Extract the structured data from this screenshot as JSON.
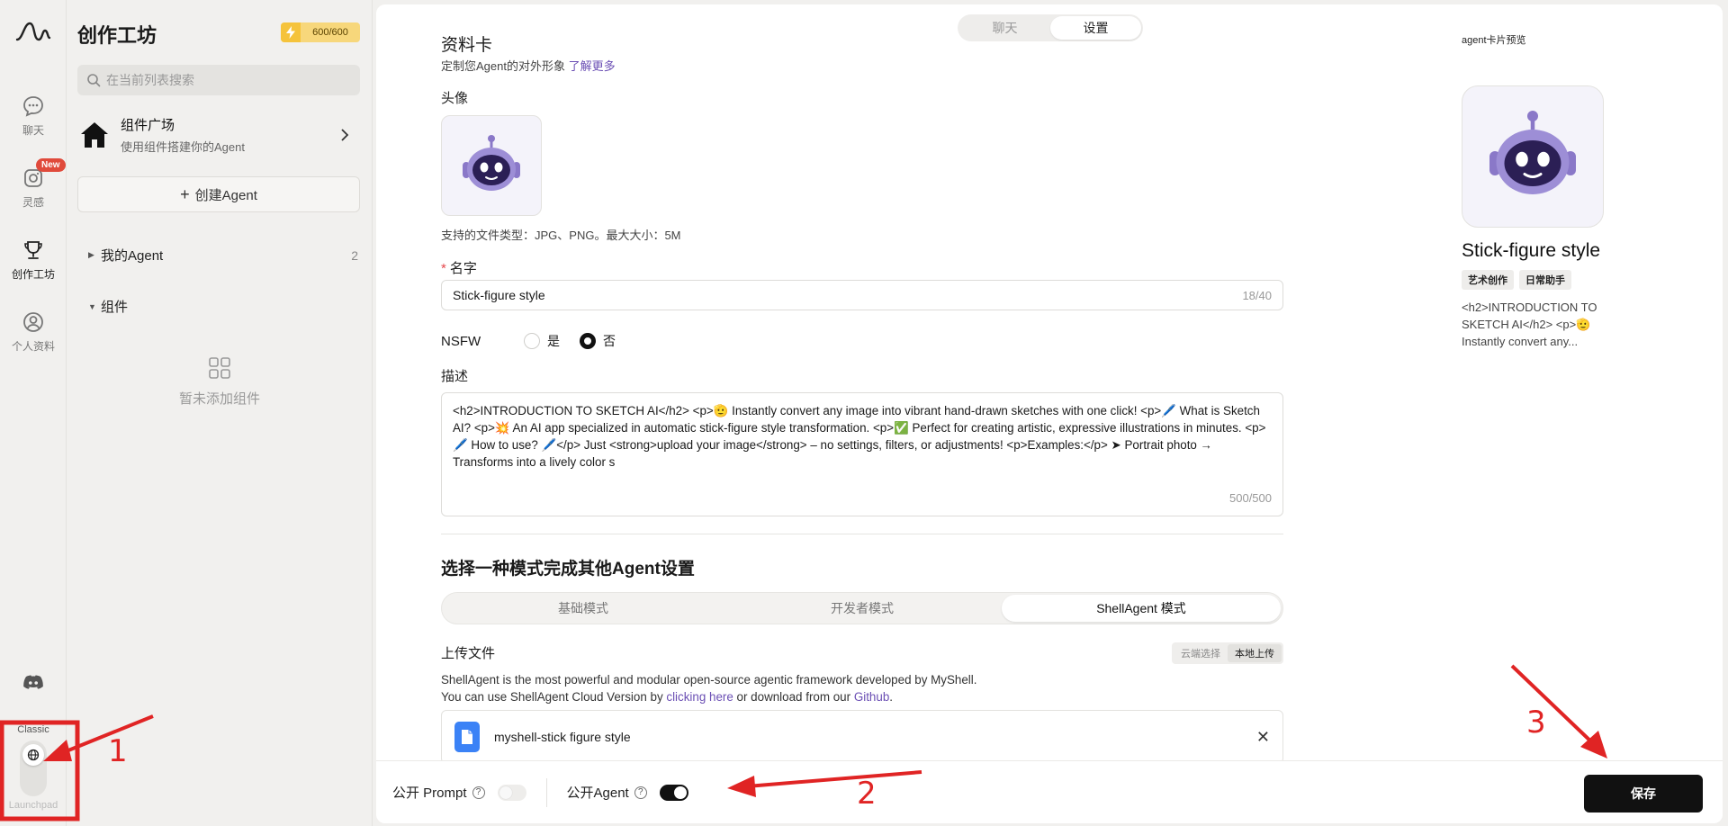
{
  "rail": {
    "items": [
      {
        "label": "聊天",
        "icon": "chat-bubble-icon"
      },
      {
        "label": "灵感",
        "icon": "inspiration-icon",
        "badge": "New"
      },
      {
        "label": "创作工坊",
        "icon": "trophy-icon",
        "active": true
      },
      {
        "label": "个人资料",
        "icon": "user-circle-icon"
      }
    ],
    "mode_toggle": {
      "top": "Classic",
      "bottom": "Launchpad"
    }
  },
  "sidebar": {
    "title": "创作工坊",
    "energy": "600/600",
    "search_placeholder": "在当前列表搜索",
    "market": {
      "title": "组件广场",
      "subtitle": "使用组件搭建你的Agent"
    },
    "create_label": "创建Agent",
    "my_agents": {
      "label": "我的Agent",
      "count": "2"
    },
    "components": {
      "label": "组件"
    },
    "empty_text": "暂未添加组件"
  },
  "tabs": {
    "chat": "聊天",
    "settings": "设置"
  },
  "form": {
    "card_title": "资料卡",
    "card_subtitle": "定制您Agent的对外形象",
    "learn_more": "了解更多",
    "avatar_label": "头像",
    "avatar_hint": "支持的文件类型：JPG、PNG。最大大小：5M",
    "name_label": "名字",
    "name_value": "Stick-figure style",
    "name_count": "18/40",
    "nsfw_label": "NSFW",
    "nsfw_yes": "是",
    "nsfw_no": "否",
    "desc_label": "描述",
    "desc_value": "<h2>INTRODUCTION TO SKETCH AI</h2> <p>🫡 Instantly convert any image into vibrant hand-drawn sketches with one click!      <p>🖊️ What is Sketch AI?      <p>💥 An AI app specialized in automatic stick-figure style transformation.      <p>✅ Perfect for creating artistic, expressive illustrations in minutes.      <p>🖊️ How to use?      🖊️</p> Just <strong>upload your image</strong> – no settings, filters, or adjustments!      <p>Examples:</p> ➤ Portrait photo → Transforms into a lively color s",
    "desc_count": "500/500",
    "mode_title": "选择一种模式完成其他Agent设置",
    "modes": [
      "基础模式",
      "开发者模式",
      "ShellAgent 模式"
    ],
    "upload_label": "上传文件",
    "upload_sources": [
      "云端选择",
      "本地上传"
    ],
    "sa_line1": "ShellAgent is the most powerful and modular open-source agentic framework developed by MyShell.",
    "sa_line2_pre": "You can use ShellAgent Cloud Version by ",
    "sa_link1": "clicking here",
    "sa_line2_mid": " or download from our ",
    "sa_link2": "Github",
    "sa_line2_end": ".",
    "file_name": "myshell-stick figure style"
  },
  "bottom": {
    "public_prompt": "公开 Prompt",
    "public_agent": "公开Agent",
    "save": "保存"
  },
  "preview": {
    "label": "agent卡片预览",
    "name": "Stick-figure style",
    "tags": [
      "艺术创作",
      "日常助手"
    ],
    "desc": "<h2>INTRODUCTION TO SKETCH AI</h2> <p>🫡 Instantly convert any..."
  },
  "annotations": [
    "1",
    "2",
    "3"
  ],
  "colors": {
    "accent_link": "#6b4fb4",
    "annotation_red": "#e02424",
    "primary": "#111111"
  }
}
